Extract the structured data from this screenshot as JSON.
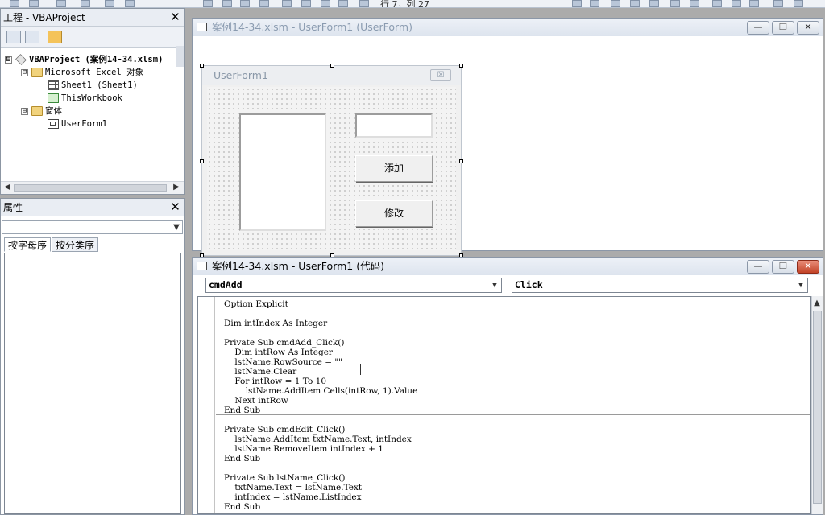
{
  "toolbar": {
    "position": "行 7，列 27"
  },
  "project": {
    "title": "工程 - VBAProject",
    "tree": [
      {
        "label": "VBAProject (案例14-34.xlsm)",
        "level": 0,
        "icon": "vbaproject-icon"
      },
      {
        "label": "Microsoft Excel 对象",
        "level": 1,
        "icon": "folder-icon"
      },
      {
        "label": "Sheet1 (Sheet1)",
        "level": 2,
        "icon": "sheet-icon"
      },
      {
        "label": "ThisWorkbook",
        "level": 2,
        "icon": "workbook-icon"
      },
      {
        "label": "窗体",
        "level": 1,
        "icon": "folder-icon"
      },
      {
        "label": "UserForm1",
        "level": 2,
        "icon": "userform-icon"
      }
    ],
    "expand_minus": "⊟"
  },
  "properties": {
    "title": "属性",
    "tabs": [
      "按字母序",
      "按分类序"
    ]
  },
  "designer": {
    "title": "案例14-34.xlsm - UserForm1 (UserForm)",
    "form": {
      "caption": "UserForm1",
      "close": "☒",
      "buttons": [
        "添加",
        "修改"
      ]
    }
  },
  "codewin": {
    "title": "案例14-34.xlsm - UserForm1 (代码)",
    "object": "cmdAdd",
    "procedure": "Click",
    "code": [
      "Option Explicit",
      "",
      "Dim intIndex As Integer",
      "",
      "Private Sub cmdAdd_Click()",
      "    Dim intRow As Integer",
      "    lstName.RowSource = \"\"",
      "    lstName.Clear",
      "    For intRow = 1 To 10",
      "        lstName.AddItem Cells(intRow, 1).Value",
      "    Next intRow",
      "End Sub",
      "",
      "Private Sub cmdEdit_Click()",
      "    lstName.AddItem txtName.Text, intIndex",
      "    lstName.RemoveItem intIndex + 1",
      "End Sub",
      "",
      "Private Sub lstName_Click()",
      "    txtName.Text = lstName.Text",
      "    intIndex = lstName.ListIndex",
      "End Sub"
    ]
  },
  "window_buttons": {
    "minimize": "—",
    "restore": "❐",
    "close": "✕"
  },
  "glyphs": {
    "close": "✕",
    "down": "▼",
    "up": "▲",
    "left": "◀",
    "right": "▶"
  }
}
